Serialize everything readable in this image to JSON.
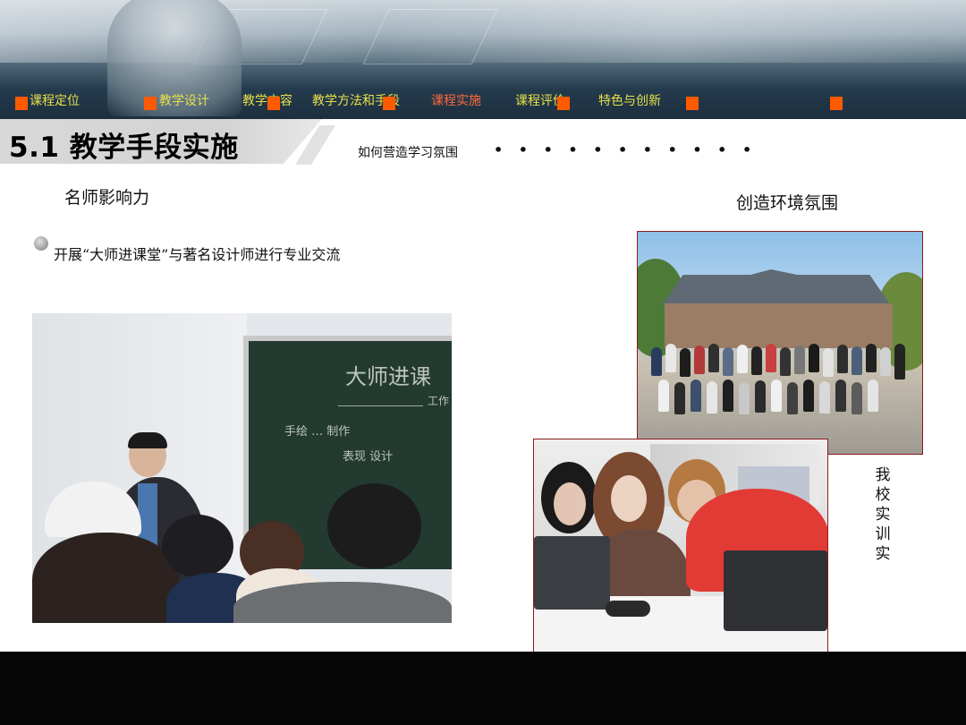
{
  "nav": {
    "items": [
      {
        "label": "课程定位",
        "active": false
      },
      {
        "label": "教学设计",
        "active": false
      },
      {
        "label": "教学内容",
        "active": false
      },
      {
        "label": "教学方法和手段",
        "active": false
      },
      {
        "label": "课程实施",
        "active": true
      },
      {
        "label": "课程评价",
        "active": false
      },
      {
        "label": "特色与创新",
        "active": false
      }
    ],
    "text_color": "#e8e04a",
    "active_color": "#ff6a3a",
    "marker_color": "#ff5a00"
  },
  "section": {
    "title": "5.1 教学手段实施",
    "subtitle": "如何营造学习氛围",
    "subtitle_dots": "• • • • • • • • • • •"
  },
  "left": {
    "heading": "名师影响力",
    "bullet": "开展“大师进课堂”与著名设计师进行专业交流",
    "blackboard_text": {
      "line1": "大师进课",
      "line2": "工作",
      "line3": "手绘  …  制作",
      "line4": "表现  设计"
    }
  },
  "right": {
    "heading": "创造环境氛围",
    "caption": "我校实训实"
  },
  "colors": {
    "photo_border": "#8a1d1d",
    "bottom_bar": "#050505"
  }
}
